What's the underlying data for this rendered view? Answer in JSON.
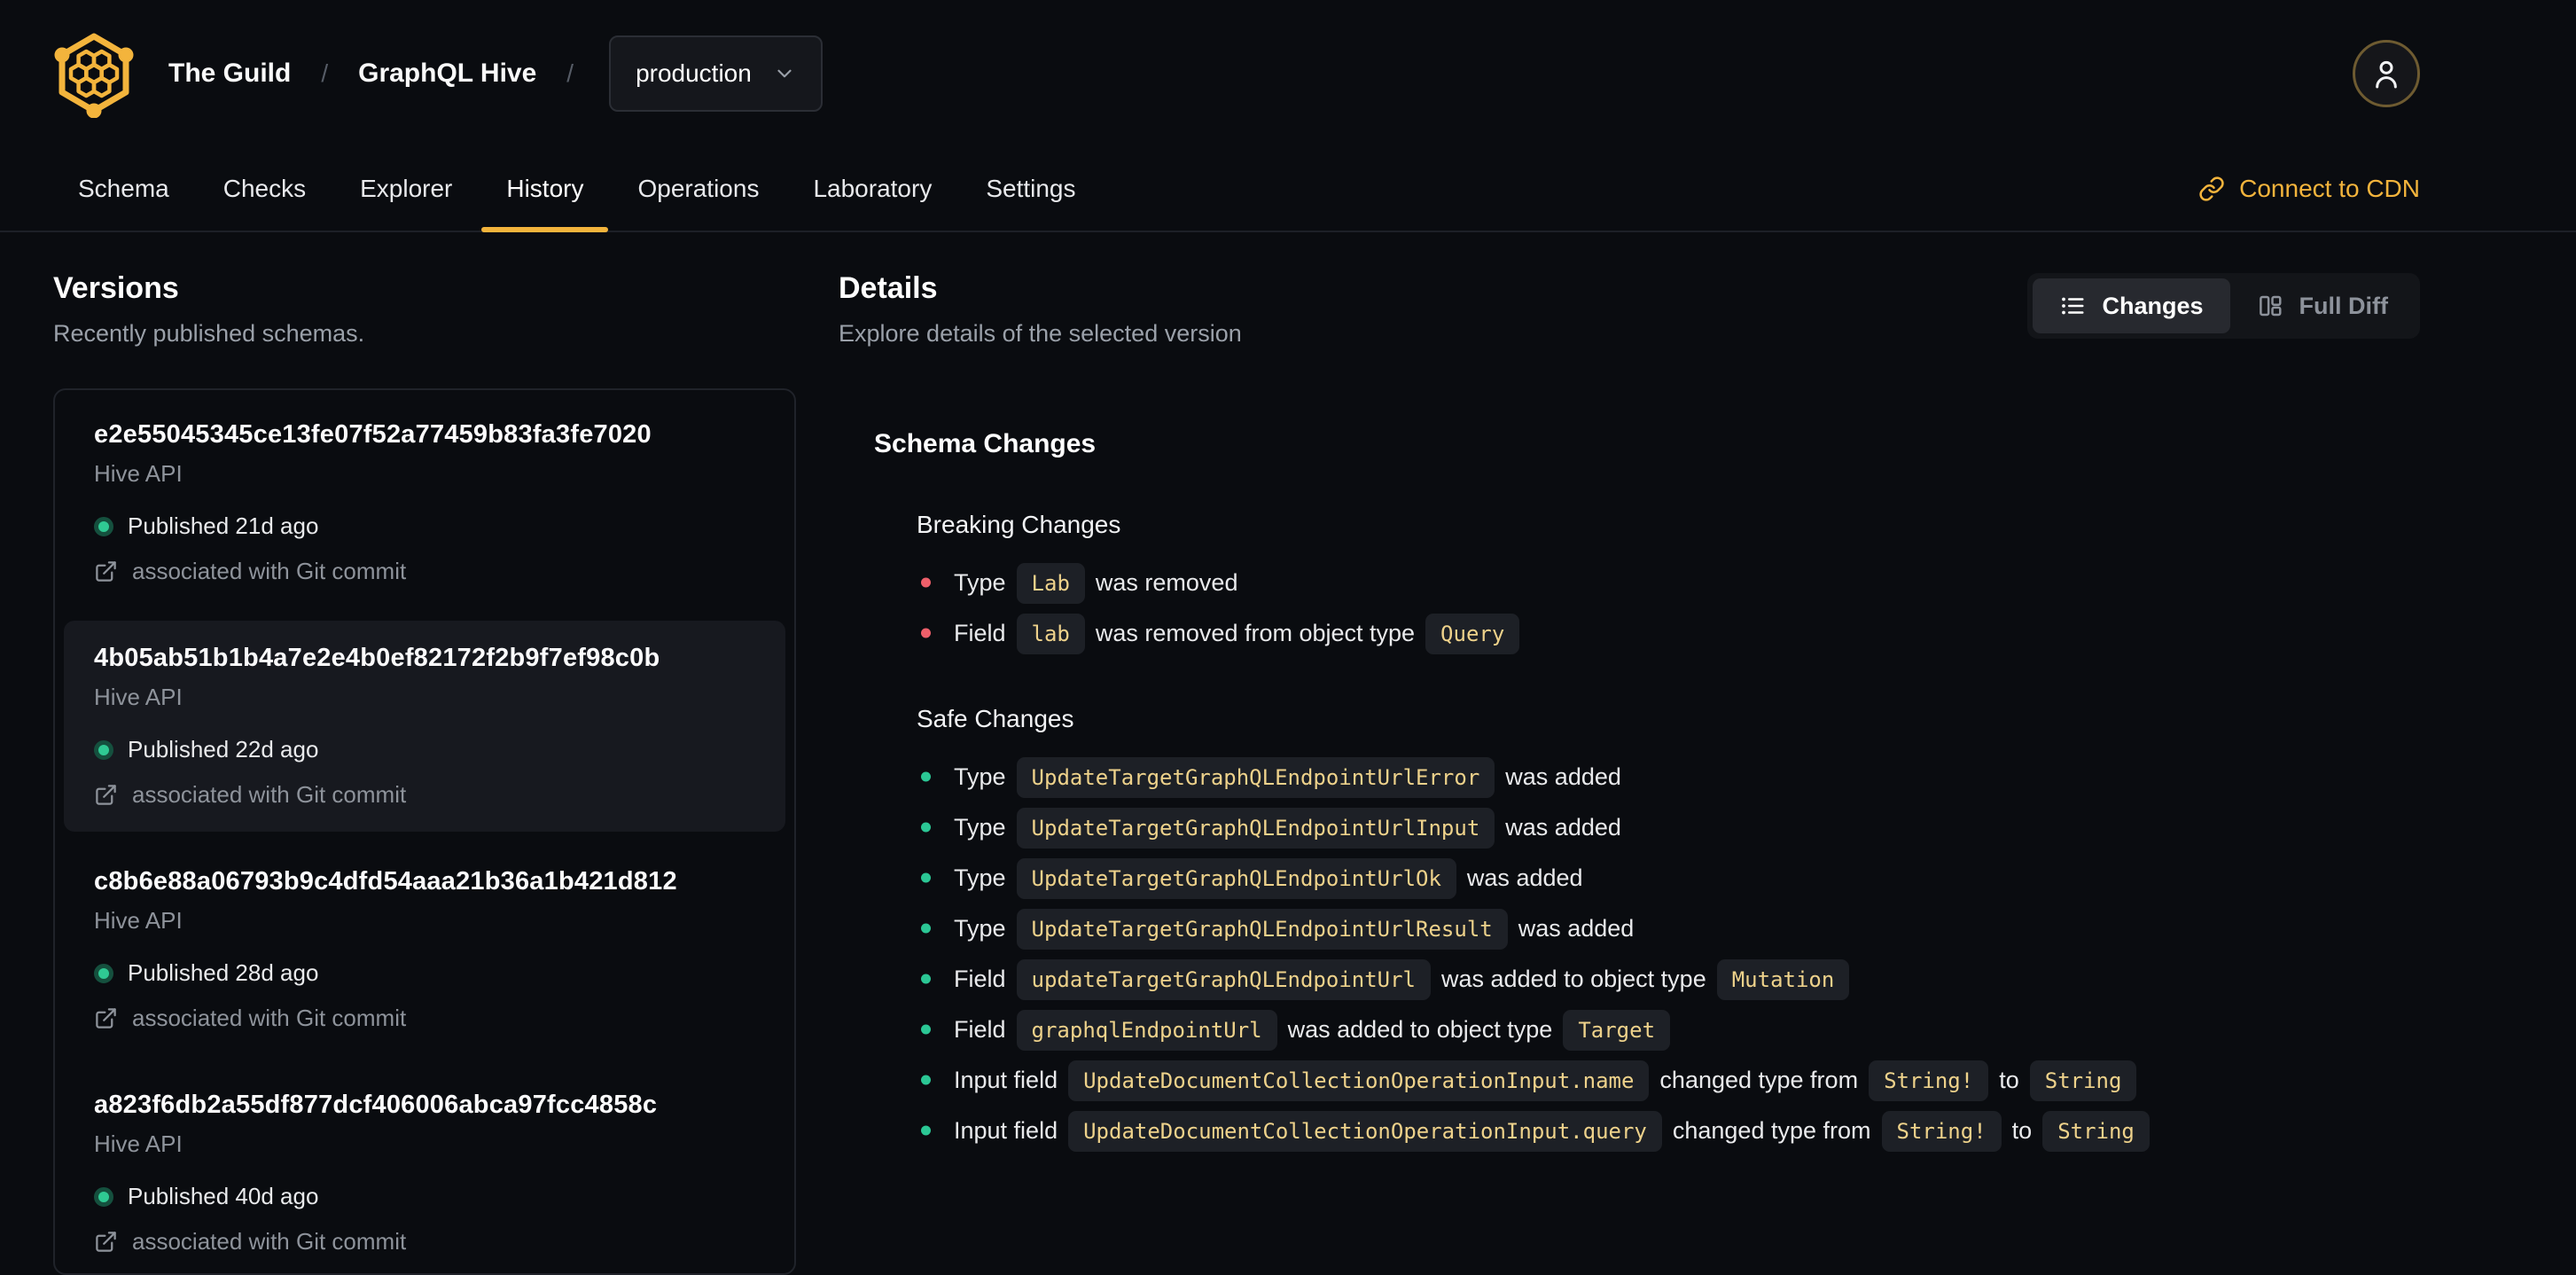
{
  "colors": {
    "accent_gold": "#f3b43c",
    "code_gold": "#eed28b",
    "breaking_red": "#ee5f6a",
    "safe_green": "#2bc795",
    "published_green": "#2fc993"
  },
  "header": {
    "breadcrumb": {
      "org": "The Guild",
      "separator": "/",
      "project": "GraphQL Hive",
      "target": "production"
    },
    "tabs": [
      {
        "label": "Schema",
        "active": false
      },
      {
        "label": "Checks",
        "active": false
      },
      {
        "label": "Explorer",
        "active": false
      },
      {
        "label": "History",
        "active": true
      },
      {
        "label": "Operations",
        "active": false
      },
      {
        "label": "Laboratory",
        "active": false
      },
      {
        "label": "Settings",
        "active": false
      }
    ],
    "connect_cdn": "Connect to CDN"
  },
  "versions_panel": {
    "title": "Versions",
    "subtitle": "Recently published schemas.",
    "items": [
      {
        "hash": "e2e55045345ce13fe07f52a77459b83fa3fe7020",
        "service": "Hive API",
        "status": "Published 21d ago",
        "git": "associated with Git commit",
        "selected": false
      },
      {
        "hash": "4b05ab51b1b4a7e2e4b0ef82172f2b9f7ef98c0b",
        "service": "Hive API",
        "status": "Published 22d ago",
        "git": "associated with Git commit",
        "selected": true
      },
      {
        "hash": "c8b6e88a06793b9c4dfd54aaa21b36a1b421d812",
        "service": "Hive API",
        "status": "Published 28d ago",
        "git": "associated with Git commit",
        "selected": false
      },
      {
        "hash": "a823f6db2a55df877dcf406006abca97fcc4858c",
        "service": "Hive API",
        "status": "Published 40d ago",
        "git": "associated with Git commit",
        "selected": false
      }
    ]
  },
  "details_panel": {
    "title": "Details",
    "subtitle": "Explore details of the selected version",
    "view_toggle": {
      "changes": "Changes",
      "full_diff": "Full Diff"
    },
    "section_title": "Schema Changes",
    "breaking_title": "Breaking Changes",
    "safe_title": "Safe Changes",
    "breaking_items": [
      [
        [
          "text",
          "Type"
        ],
        [
          "code",
          "Lab"
        ],
        [
          "text",
          "was removed"
        ]
      ],
      [
        [
          "text",
          "Field"
        ],
        [
          "code",
          "lab"
        ],
        [
          "text",
          "was removed from object type"
        ],
        [
          "code",
          "Query"
        ]
      ]
    ],
    "safe_items": [
      [
        [
          "text",
          "Type"
        ],
        [
          "code",
          "UpdateTargetGraphQLEndpointUrlError"
        ],
        [
          "text",
          "was added"
        ]
      ],
      [
        [
          "text",
          "Type"
        ],
        [
          "code",
          "UpdateTargetGraphQLEndpointUrlInput"
        ],
        [
          "text",
          "was added"
        ]
      ],
      [
        [
          "text",
          "Type"
        ],
        [
          "code",
          "UpdateTargetGraphQLEndpointUrlOk"
        ],
        [
          "text",
          "was added"
        ]
      ],
      [
        [
          "text",
          "Type"
        ],
        [
          "code",
          "UpdateTargetGraphQLEndpointUrlResult"
        ],
        [
          "text",
          "was added"
        ]
      ],
      [
        [
          "text",
          "Field"
        ],
        [
          "code",
          "updateTargetGraphQLEndpointUrl"
        ],
        [
          "text",
          "was added to object type"
        ],
        [
          "code",
          "Mutation"
        ]
      ],
      [
        [
          "text",
          "Field"
        ],
        [
          "code",
          "graphqlEndpointUrl"
        ],
        [
          "text",
          "was added to object type"
        ],
        [
          "code",
          "Target"
        ]
      ],
      [
        [
          "text",
          "Input field"
        ],
        [
          "code",
          "UpdateDocumentCollectionOperationInput.name"
        ],
        [
          "text",
          "changed type from"
        ],
        [
          "code",
          "String!"
        ],
        [
          "text",
          "to"
        ],
        [
          "code",
          "String"
        ]
      ],
      [
        [
          "text",
          "Input field"
        ],
        [
          "code",
          "UpdateDocumentCollectionOperationInput.query"
        ],
        [
          "text",
          "changed type from"
        ],
        [
          "code",
          "String!"
        ],
        [
          "text",
          "to"
        ],
        [
          "code",
          "String"
        ]
      ]
    ]
  }
}
